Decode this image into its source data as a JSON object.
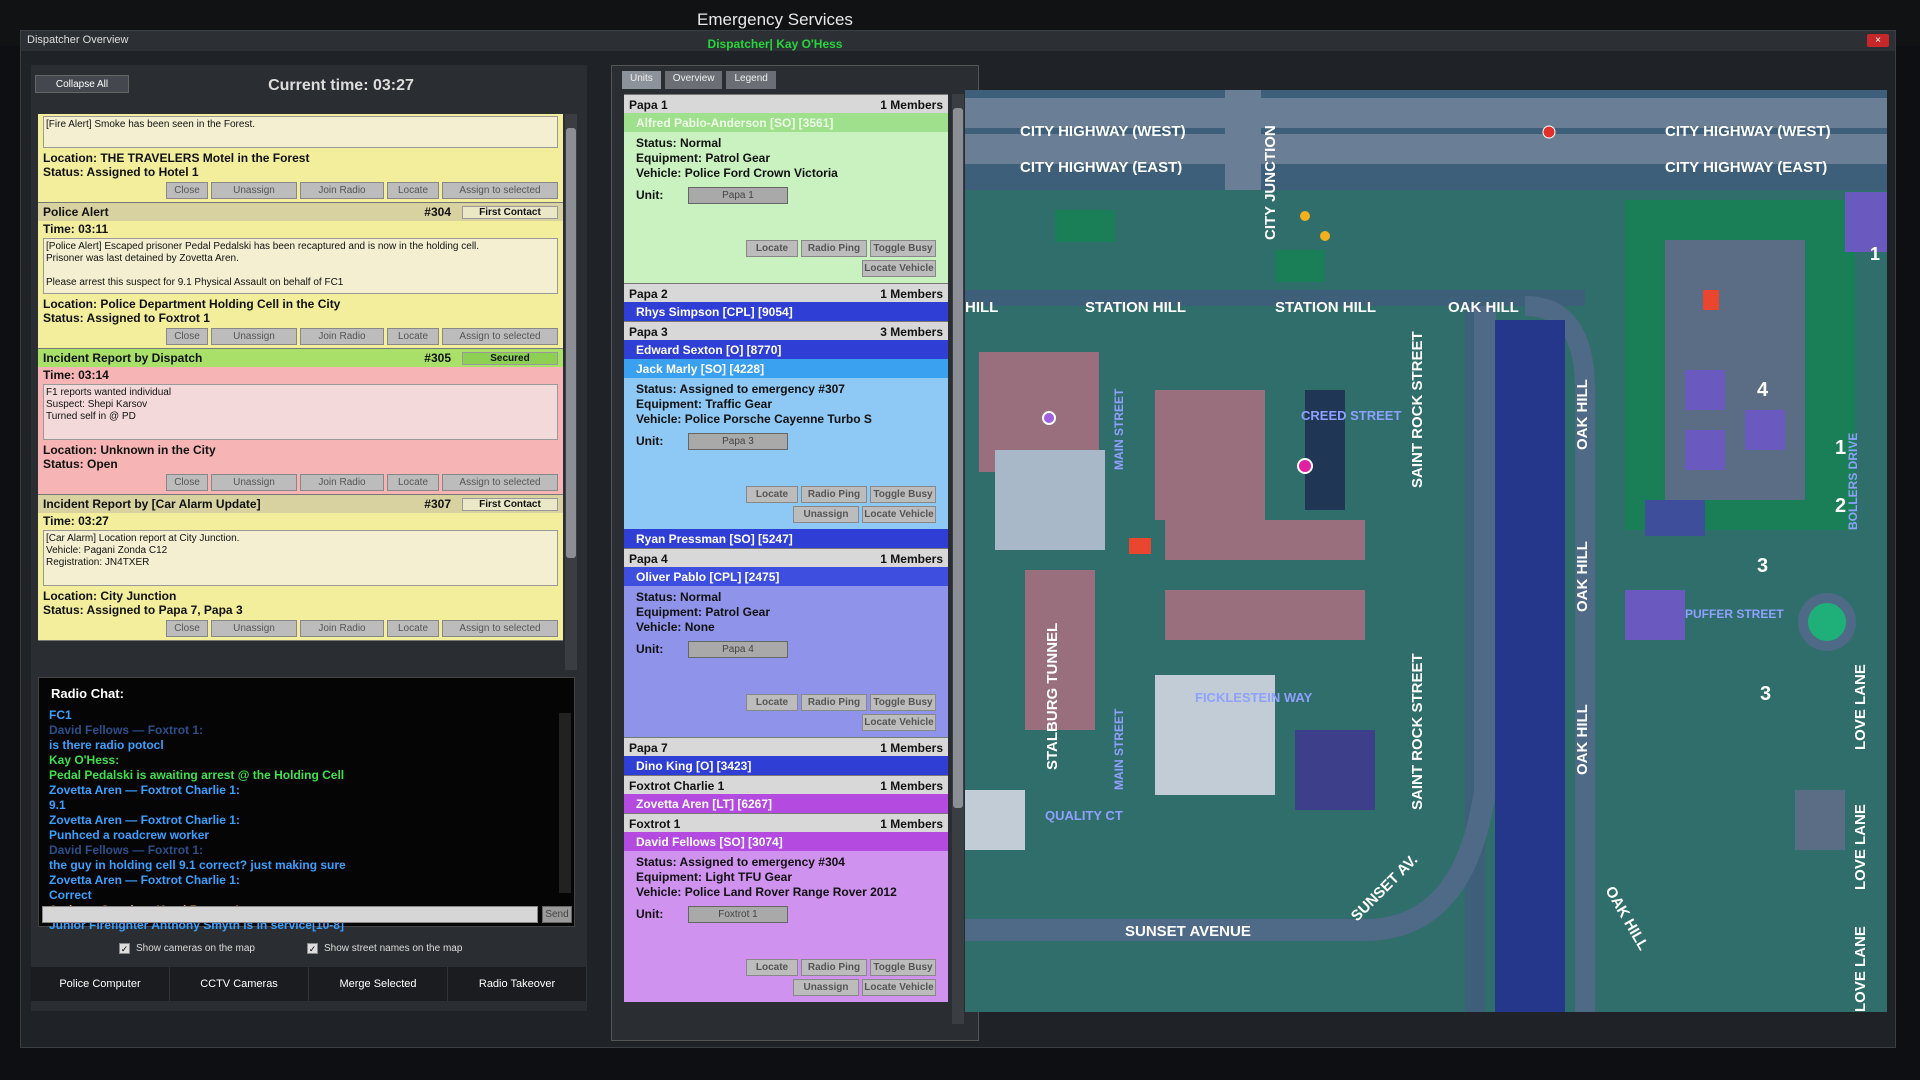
{
  "app": {
    "title": "Emergency Services",
    "subtitle": "Dispatcher| Kay O'Hess"
  },
  "window": {
    "title": "Dispatcher Overview",
    "close": "×"
  },
  "left": {
    "collapse_all": "Collapse All",
    "clock": "Current time: 03:27"
  },
  "incidents": [
    {
      "header": "",
      "num": "",
      "status": "",
      "time": "",
      "desc": [
        "[Fire Alert] Smoke has been seen in the Forest."
      ],
      "location": "Location: THE TRAVELERS Motel in the Forest",
      "assign": "Status: Assigned to Hotel 1",
      "color": "yellow"
    },
    {
      "header": "Police Alert",
      "num": "#304",
      "status": "First Contact",
      "time": "Time: 03:11",
      "desc": [
        "[Police Alert] Escaped prisoner Pedal Pedalski has been recaptured and is now in the holding cell.",
        "Prisoner was last detained by Zovetta Aren.",
        "",
        "Please arrest this suspect for 9.1 Physical Assault on behalf of FC1"
      ],
      "location": "Location: Police Department Holding Cell in the City",
      "assign": "Status: Assigned to Foxtrot 1",
      "color": "yellow"
    },
    {
      "header": "Incident Report by Dispatch",
      "num": "#305",
      "status": "Secured",
      "time": "Time: 03:14",
      "desc": [
        "F1 reports wanted individual",
        "Suspect: Shepi Karsov",
        "Turned self in @ PD"
      ],
      "location": "Location: Unknown in the City",
      "assign": "Status: Open",
      "color": "red"
    },
    {
      "header": "Incident Report by [Car Alarm Update]",
      "num": "#307",
      "status": "First Contact",
      "time": "Time: 03:27",
      "desc": [
        "[Car Alarm] Location report at City Junction.",
        "Vehicle: Pagani Zonda C12",
        "Registration: JN4TXER"
      ],
      "location": "Location: City Junction",
      "assign": "Status: Assigned to Papa 7, Papa 3",
      "color": "yellow"
    }
  ],
  "incident_buttons": {
    "close": "Close",
    "unassign": "Unassign",
    "join": "Join Radio",
    "locate": "Locate",
    "assign": "Assign to selected"
  },
  "radio": {
    "title": "Radio Chat:",
    "send": "Send",
    "lines": [
      {
        "t": "FC1",
        "c": "#3aa0ff"
      },
      {
        "t": "David Fellows — Foxtrot 1:",
        "c": "#2a4f8c"
      },
      {
        "t": "is there radio potocl",
        "c": "#3aa0ff"
      },
      {
        "t": "Kay O'Hess:",
        "c": "#3ee04a"
      },
      {
        "t": "Pedal Pedalski is awaiting arrest @ the Holding Cell",
        "c": "#3ee04a"
      },
      {
        "t": "Zovetta Aren — Foxtrot Charlie 1:",
        "c": "#3aa0ff"
      },
      {
        "t": "9.1",
        "c": "#3aa0ff"
      },
      {
        "t": "Zovetta Aren — Foxtrot Charlie 1:",
        "c": "#3aa0ff"
      },
      {
        "t": "Punhced a roadcrew worker",
        "c": "#3aa0ff"
      },
      {
        "t": "David Fellows — Foxtrot 1:",
        "c": "#2a4f8c"
      },
      {
        "t": "the guy in holding cell 9.1 correct? just making sure",
        "c": "#3aa0ff"
      },
      {
        "t": "Zovetta Aren — Foxtrot Charlie 1:",
        "c": "#3aa0ff"
      },
      {
        "t": "Correct",
        "c": "#3aa0ff"
      },
      {
        "t": "Anthony Smyth — Hotel Romeo 1:",
        "c": "#f0a030"
      },
      {
        "t": "Junior Firefighter Anthony Smyth is in service[10-8]",
        "c": "#3aa0ff"
      }
    ]
  },
  "options": {
    "cameras": "Show cameras on the map",
    "streets": "Show street names on the map",
    "check": "✓"
  },
  "bottom_tabs": [
    "Police Computer",
    "CCTV Cameras",
    "Merge Selected",
    "Radio Takeover"
  ],
  "mid_tabs": [
    "Units",
    "Overview",
    "Legend"
  ],
  "unit_buttons": {
    "locate": "Locate",
    "ping": "Radio Ping",
    "busy": "Toggle Busy",
    "unassign": "Unassign",
    "vehicle": "Locate Vehicle",
    "unit_label": "Unit:"
  },
  "groups": [
    {
      "name": "Papa 1",
      "count": "1 Members",
      "members": [
        {
          "name": "Alfred Pablo-Anderson [SO] [3561]",
          "color": "#9ee08c",
          "nameColor": "#eefce8",
          "body": true,
          "bodyBg": "#c9f2c0",
          "status": "Status: Normal",
          "equip": "Equipment: Patrol Gear",
          "vehicle": "Vehicle: Police Ford Crown Victoria",
          "unit": "Papa 1",
          "unassign": false
        }
      ]
    },
    {
      "name": "Papa 2",
      "count": "1 Members",
      "members": [
        {
          "name": "Rhys Simpson [CPL] [9054]",
          "color": "#2f3fd6",
          "nameColor": "#fff",
          "body": false
        }
      ]
    },
    {
      "name": "Papa 3",
      "count": "3 Members",
      "members": [
        {
          "name": "Edward Sexton [O] [8770]",
          "color": "#2f3fd6",
          "nameColor": "#fff",
          "body": false
        },
        {
          "name": "Jack Marly [SO] [4228]",
          "color": "#3aa0f0",
          "nameColor": "#fff",
          "body": true,
          "bodyBg": "#8ec8f4",
          "status": "Status: Assigned to emergency #307",
          "equip": "Equipment: Traffic Gear",
          "vehicle": "Vehicle: Police Porsche Cayenne Turbo S",
          "unit": "Papa 3",
          "unassign": true
        },
        {
          "name": "Ryan Pressman [SO] [5247]",
          "color": "#2f3fd6",
          "nameColor": "#fff",
          "body": false
        }
      ]
    },
    {
      "name": "Papa 4",
      "count": "1 Members",
      "members": [
        {
          "name": "Oliver Pablo [CPL] [2475]",
          "color": "#3e4fe0",
          "nameColor": "#fff",
          "body": true,
          "bodyBg": "#8f94ea",
          "status": "Status: Normal",
          "equip": "Equipment: Patrol Gear",
          "vehicle": "Vehicle: None",
          "unit": "Papa 4",
          "unassign": false
        }
      ]
    },
    {
      "name": "Papa 7",
      "count": "1 Members",
      "members": [
        {
          "name": "Dino King [O] [3423]",
          "color": "#2f3fd6",
          "nameColor": "#fff",
          "body": false
        }
      ]
    },
    {
      "name": "Foxtrot Charlie 1",
      "count": "1 Members",
      "members": [
        {
          "name": "Zovetta Aren [LT] [6267]",
          "color": "#b44ae0",
          "nameColor": "#fff",
          "body": false
        }
      ]
    },
    {
      "name": "Foxtrot 1",
      "count": "1 Members",
      "members": [
        {
          "name": "David Fellows [SO] [3074]",
          "color": "#b44ae0",
          "nameColor": "#fff",
          "body": true,
          "bodyBg": "#cf92ee",
          "status": "Status: Assigned to emergency #304",
          "equip": "Equipment: Light TFU Gear",
          "vehicle": "Vehicle: Police Land Rover Range Rover 2012",
          "unit": "Foxtrot 1",
          "unassign": true
        }
      ]
    }
  ],
  "map": {
    "labels": {
      "hw_west": "CITY HIGHWAY",
      "hw_west_b": "(WEST)",
      "hw_east": "CITY HIGHWAY",
      "hw_east_b": "(EAST)",
      "hw_west2": "CITY HIGHWAY",
      "hw_east2": "CITY HIGHWAY",
      "city_junction": "CITY JUNCTION",
      "station_hill": "STATION HILL",
      "station_hill2": "STATION HILL",
      "oak_hill": "OAK HILL",
      "hill": "HILL",
      "saint_rock": "SAINT ROCK STREET",
      "saint_rock2": "SAINT ROCK STREET",
      "oak_hill_v": "OAK HILL",
      "oak_hill_v2": "OAK HILL",
      "oak_hill_v3": "OAK HILL",
      "oak_hill_v4": "OAK HILL",
      "creed": "CREED STREET",
      "main": "MAIN STREET",
      "main2": "MAIN STREET",
      "stalburg": "STALBURG TUNNEL",
      "ficklestein": "FICKLESTEIN WAY",
      "quality": "QUALITY CT",
      "sunset_av": "SUNSET AV.",
      "sunset_avenue": "SUNSET AVENUE",
      "love1": "LOVE LANE",
      "love2": "LOVE LANE",
      "love3": "LOVE LANE",
      "puffer": "PUFFER STREET",
      "bollers": "BOLLERS DRIVE",
      "b4": "4",
      "b1": "1",
      "b2": "2",
      "b3": "3",
      "b3b": "3",
      "b1b": "1"
    }
  }
}
